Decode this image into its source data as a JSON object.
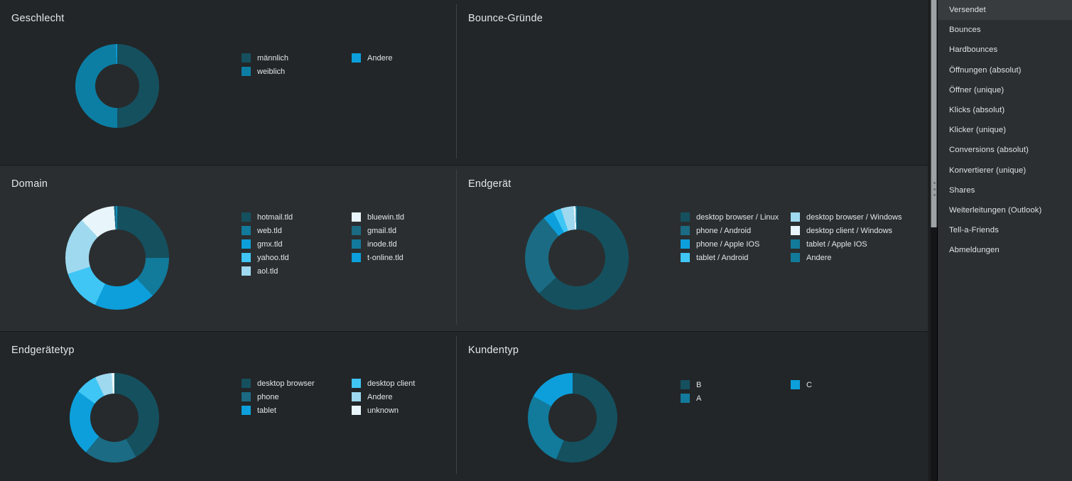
{
  "palette": {
    "background": "#212528",
    "row_odd": "#222628",
    "row_even": "#2a2e30",
    "sidebar_bg": "#2b2f31",
    "sidebar_active": "#383c3e",
    "text": "#e2e6e8",
    "divider": "#3c4246",
    "c1": "#15505f",
    "c2": "#0c7ea4",
    "c3": "#0c9fdb",
    "c4": "#3fc6f5",
    "c5": "#9fd9ef",
    "c6": "#dcf0f8",
    "c7": "#1b6b84",
    "c8": "#127a9b",
    "c9": "#e8f5fb"
  },
  "sidebar": {
    "items": [
      {
        "label": "Versendet",
        "active": true
      },
      {
        "label": "Bounces",
        "active": false
      },
      {
        "label": "Hardbounces",
        "active": false
      },
      {
        "label": "Öffnungen (absolut)",
        "active": false
      },
      {
        "label": "Öffner (unique)",
        "active": false
      },
      {
        "label": "Klicks (absolut)",
        "active": false
      },
      {
        "label": "Klicker (unique)",
        "active": false
      },
      {
        "label": "Conversions (absolut)",
        "active": false
      },
      {
        "label": "Konvertierer (unique)",
        "active": false
      },
      {
        "label": "Shares",
        "active": false
      },
      {
        "label": "Weiterleitungen (Outlook)",
        "active": false
      },
      {
        "label": "Tell-a-Friends",
        "active": false
      },
      {
        "label": "Abmeldungen",
        "active": false
      }
    ]
  },
  "chart_data": [
    {
      "id": "geschlecht",
      "type": "pie",
      "title": "Geschlecht",
      "donut": true,
      "legend_position": "right",
      "legend_columns": 2,
      "legend_rows": 2,
      "categories": [
        "männlich",
        "weiblich",
        "Andere"
      ],
      "values": [
        50.0,
        49.5,
        0.5
      ],
      "colors": [
        "#15505f",
        "#0c7ea4",
        "#0c9fdb"
      ],
      "size": 118,
      "hole": 62
    },
    {
      "id": "bounce-gruende",
      "type": "pie",
      "title": "Bounce-Gründe",
      "donut": true,
      "legend_position": "right",
      "legend_columns": 2,
      "legend_rows": 0,
      "categories": [],
      "values": [],
      "colors": [],
      "size": 0,
      "hole": 0,
      "empty": true
    },
    {
      "id": "domain",
      "type": "pie",
      "title": "Domain",
      "donut": true,
      "legend_position": "right",
      "legend_columns": 2,
      "legend_rows": 5,
      "categories": [
        "hotmail.tld",
        "web.tld",
        "gmx.tld",
        "yahoo.tld",
        "aol.tld",
        "bluewin.tld",
        "gmail.tld",
        "inode.tld",
        "t-online.tld"
      ],
      "values": [
        25.0,
        13.0,
        19.0,
        13.0,
        18.0,
        11.0,
        0.5,
        0.3,
        0.2
      ],
      "colors": [
        "#15505f",
        "#127a9b",
        "#0c9fdb",
        "#3fc6f5",
        "#9fd9ef",
        "#e8f5fb",
        "#1b6b84",
        "#127a9b",
        "#0c9fdb"
      ],
      "size": 146,
      "hole": 80
    },
    {
      "id": "endgeraet",
      "type": "pie",
      "title": "Endgerät",
      "donut": true,
      "legend_position": "right",
      "legend_columns": 2,
      "legend_rows": 4,
      "categories": [
        "desktop browser / Linux",
        "phone / Android",
        "phone / Apple IOS",
        "tablet / Android",
        "desktop browser / Windows",
        "desktop client / Windows",
        "tablet / Apple IOS",
        "Andere"
      ],
      "values": [
        63.0,
        26.0,
        3.5,
        2.5,
        4.0,
        0.6,
        0.3,
        0.1
      ],
      "colors": [
        "#15505f",
        "#1b6b84",
        "#0c9fdb",
        "#3fc6f5",
        "#9fd9ef",
        "#e8f5fb",
        "#127a9b",
        "#127a9b"
      ],
      "size": 146,
      "hole": 80
    },
    {
      "id": "endgeraetetyp",
      "type": "pie",
      "title": "Endgerätetyp",
      "donut": true,
      "legend_position": "right",
      "legend_columns": 2,
      "legend_rows": 3,
      "categories": [
        "desktop browser",
        "phone",
        "tablet",
        "desktop client",
        "Andere",
        "unknown"
      ],
      "values": [
        42.0,
        19.0,
        24.0,
        8.0,
        6.0,
        1.0
      ],
      "colors": [
        "#15505f",
        "#1b6b84",
        "#0c9fdb",
        "#3fc6f5",
        "#9fd9ef",
        "#e8f5fb"
      ],
      "size": 126,
      "hole": 68
    },
    {
      "id": "kundentyp",
      "type": "pie",
      "title": "Kundentyp",
      "donut": true,
      "legend_position": "right",
      "legend_columns": 2,
      "legend_rows": 2,
      "categories": [
        "B",
        "A",
        "C"
      ],
      "values": [
        56.0,
        27.0,
        17.0
      ],
      "colors": [
        "#15505f",
        "#127a9b",
        "#0c9fdb"
      ],
      "size": 126,
      "hole": 68
    }
  ]
}
